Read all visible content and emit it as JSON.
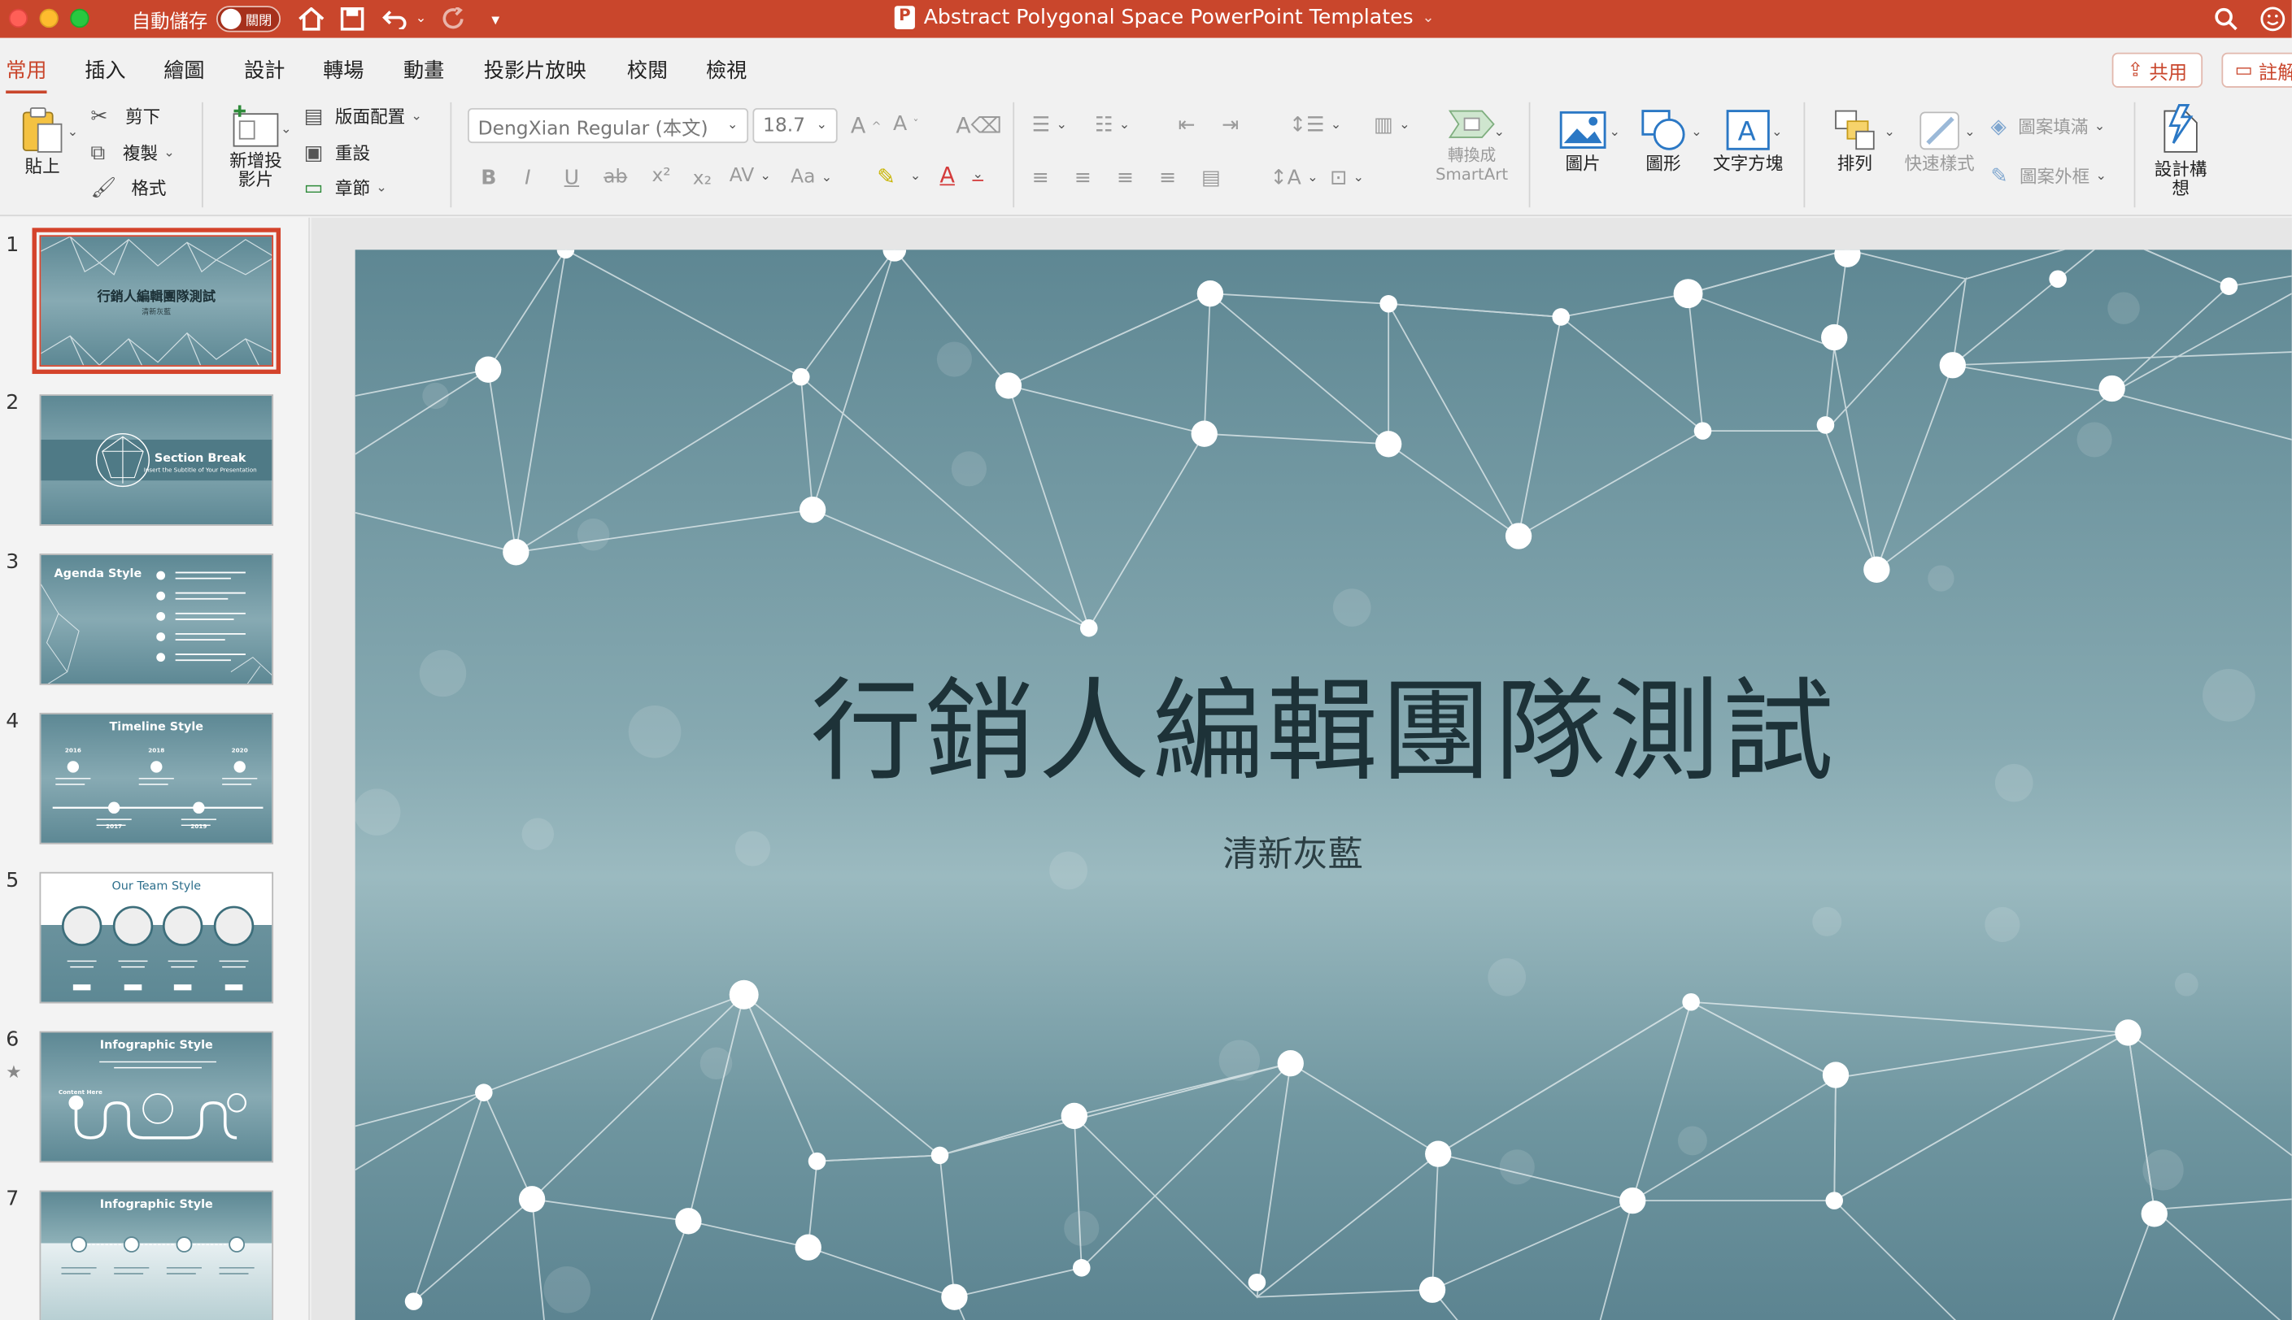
{
  "titlebar": {
    "autosave_label": "自動儲存",
    "autosave_state": "關閉",
    "doc_title": "Abstract Polygonal Space PowerPoint Templates",
    "home_icon": "home-icon",
    "save_icon": "save-icon",
    "undo_icon": "undo-icon",
    "redo_icon": "redo-icon",
    "customize_icon": "customize-toolbar-icon",
    "search_icon": "search-icon",
    "smiley_icon": "feedback-smiley-icon",
    "accent": "#c9462c"
  },
  "tabs": [
    "常用",
    "插入",
    "繪圖",
    "設計",
    "轉場",
    "動畫",
    "投影片放映",
    "校閱",
    "檢視"
  ],
  "share_label": "共用",
  "comment_label": "註解",
  "ribbon": {
    "paste": "貼上",
    "cut": "剪下",
    "copy": "複製",
    "format": "格式",
    "new_slide": "新增投影片",
    "layout": "版面配置",
    "reset": "重設",
    "section": "章節",
    "font_name": "DengXian Regular (本文)",
    "font_size": "18.7",
    "convert_smartart": "轉換成SmartArt",
    "picture": "圖片",
    "shape": "圖形",
    "textbox": "文字方塊",
    "arrange": "排列",
    "quick_styles": "快速樣式",
    "shape_fill": "圖案填滿",
    "shape_outline": "圖案外框",
    "design_ideas": "設計構想"
  },
  "thumbnails": [
    {
      "num": "1",
      "title": "行銷人編輯團隊測試",
      "subtitle": "清新灰藍",
      "selected": true
    },
    {
      "num": "2",
      "title": "Section Break",
      "subtitle": "Insert the Subtitle of Your Presentation"
    },
    {
      "num": "3",
      "title": "Agenda Style"
    },
    {
      "num": "4",
      "title": "Timeline Style",
      "years": [
        "2016",
        "2017",
        "2018",
        "2019",
        "2020"
      ]
    },
    {
      "num": "5",
      "title": "Our Team Style"
    },
    {
      "num": "6",
      "title": "Infographic Style",
      "label": "Content Here"
    },
    {
      "num": "7",
      "title": "Infographic Style"
    }
  ],
  "slide": {
    "title": "行銷人編輯團隊測試",
    "subtitle": "清新灰藍"
  }
}
